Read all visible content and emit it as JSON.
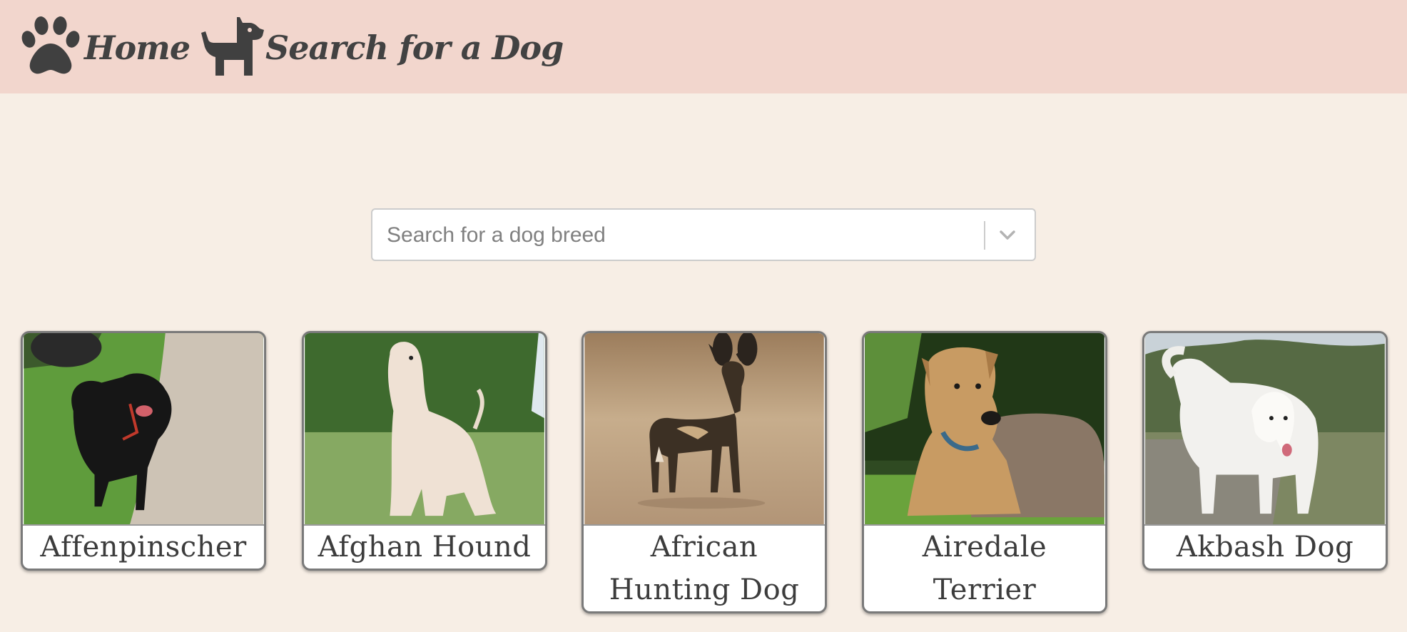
{
  "nav": {
    "home_label": "Home",
    "home_icon": "paw-icon",
    "search_label": "Search for a Dog",
    "search_icon": "dog-icon"
  },
  "search": {
    "placeholder": "Search for a dog breed",
    "value": "",
    "dropdown_icon": "chevron-down-icon"
  },
  "breeds": [
    {
      "name": "Affenpinscher"
    },
    {
      "name": "Afghan Hound"
    },
    {
      "name": "African Hunting Dog"
    },
    {
      "name": "Airedale Terrier"
    },
    {
      "name": "Akbash Dog"
    }
  ],
  "colors": {
    "page_background": "#f7eee5",
    "navbar_background": "#f2d6cd",
    "text": "#424242",
    "card_border": "#7a7a7a"
  }
}
